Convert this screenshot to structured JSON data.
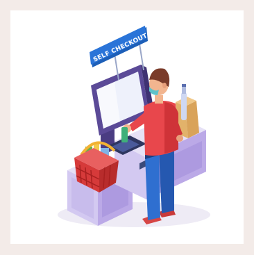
{
  "sign": {
    "label": "SELF CHECKOUT"
  },
  "colors": {
    "page_background": "#f3ebe8",
    "frame_background": "#ffffff",
    "counter_top": "#e6e1f6",
    "counter_front": "#d3c9f1",
    "counter_side": "#bba9e7",
    "screen_bezel": "#5b4a97",
    "screen_glass": "#eef1fb",
    "sign_blue": "#2a74d8",
    "basket_red": "#d63a3a",
    "shirt_red": "#e8474c",
    "jeans_blue": "#2f6fd0",
    "hair_brown": "#7a3b2a",
    "bag_tan": "#e2b26a"
  },
  "icons": [
    "self-checkout-sign-icon",
    "kiosk-screen-icon",
    "shopping-basket-icon",
    "shopper-person-icon",
    "paper-bag-icon",
    "bottle-icon"
  ]
}
